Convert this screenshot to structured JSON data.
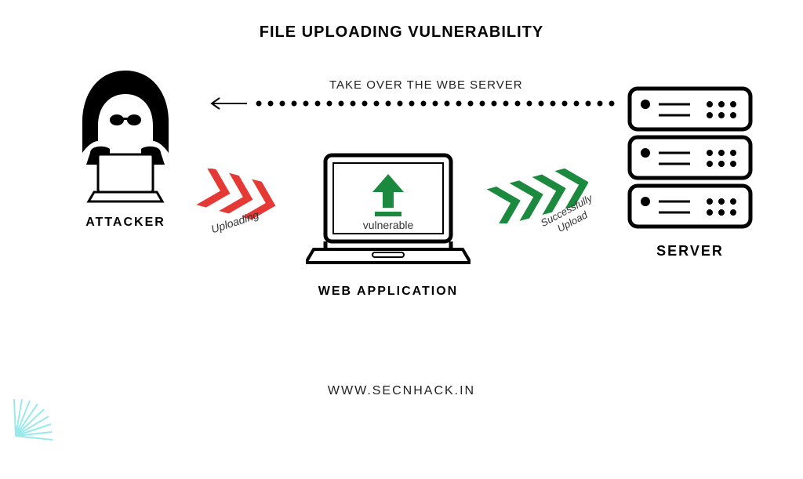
{
  "title": "FILE UPLOADING VULNERABILITY",
  "takeover_label": "TAKE OVER THE WBE SERVER",
  "attacker": {
    "label": "ATTACKER"
  },
  "webapp": {
    "label": "WEB APPLICATION",
    "screen_text": "vulnerable"
  },
  "server": {
    "label": "SERVER"
  },
  "flow": {
    "uploading": "Uploading",
    "success_line1": "Successfully",
    "success_line2": "Upload"
  },
  "footer_url": "WWW.SECNHACK.IN",
  "colors": {
    "red": "#e53935",
    "green": "#1b8a3e",
    "black": "#000000"
  }
}
